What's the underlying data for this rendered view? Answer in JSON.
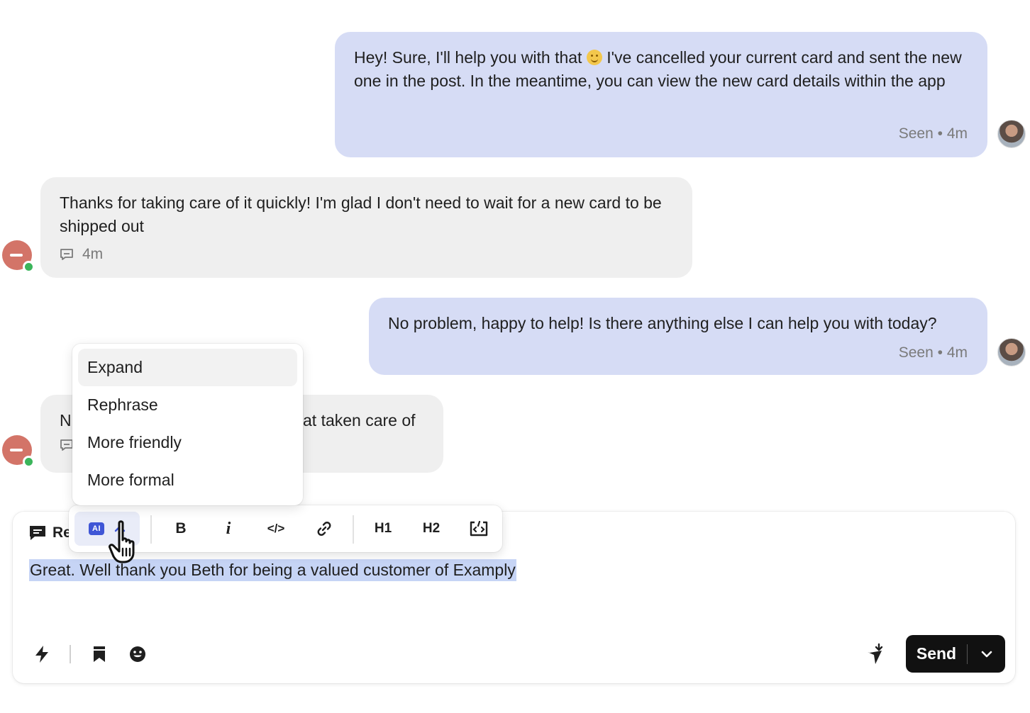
{
  "messages": [
    {
      "id": "m1",
      "direction": "outgoing",
      "text_before_emoji": "Hey! Sure, I'll help you with that",
      "emoji": "slightly-smiling-face",
      "text_after_emoji": "I've cancelled your current card and sent the new one in the post. In the meantime, you can view the new card details within the app",
      "status": "Seen",
      "time": "4m"
    },
    {
      "id": "m2",
      "direction": "incoming",
      "text": "Thanks for taking care of it quickly! I'm glad I don't need to wait for a new card to be shipped out",
      "time": "4m",
      "meta_icon": "message-square-icon"
    },
    {
      "id": "m3",
      "direction": "outgoing",
      "text": "No problem, happy to help! Is there anything else I can help you with today?",
      "status": "Seen",
      "time": "4m"
    },
    {
      "id": "m4",
      "direction": "incoming",
      "text_left": "N",
      "text_right": "at taken care of",
      "meta_icon": "message-square-icon"
    }
  ],
  "status_separator": "•",
  "ai_menu": {
    "items": [
      "Expand",
      "Rephrase",
      "More friendly",
      "More formal"
    ],
    "highlighted_index": 0
  },
  "format_toolbar": {
    "ai_badge": "AI",
    "buttons": [
      "B",
      "i",
      "</>",
      "link",
      "H1",
      "H2",
      "embed"
    ],
    "h1_label": "H1",
    "h2_label": "H2"
  },
  "composer": {
    "reply_label": "Re",
    "draft_text": "Great. Well thank you Beth for being a valued customer of Examply",
    "send_label": "Send"
  },
  "colors": {
    "outgoing_bubble": "#d6dcf5",
    "incoming_bubble": "#efefef",
    "ai_badge": "#3f56d6",
    "selection": "#c6d4f5",
    "send_button": "#111111",
    "online": "#3bb55b"
  }
}
